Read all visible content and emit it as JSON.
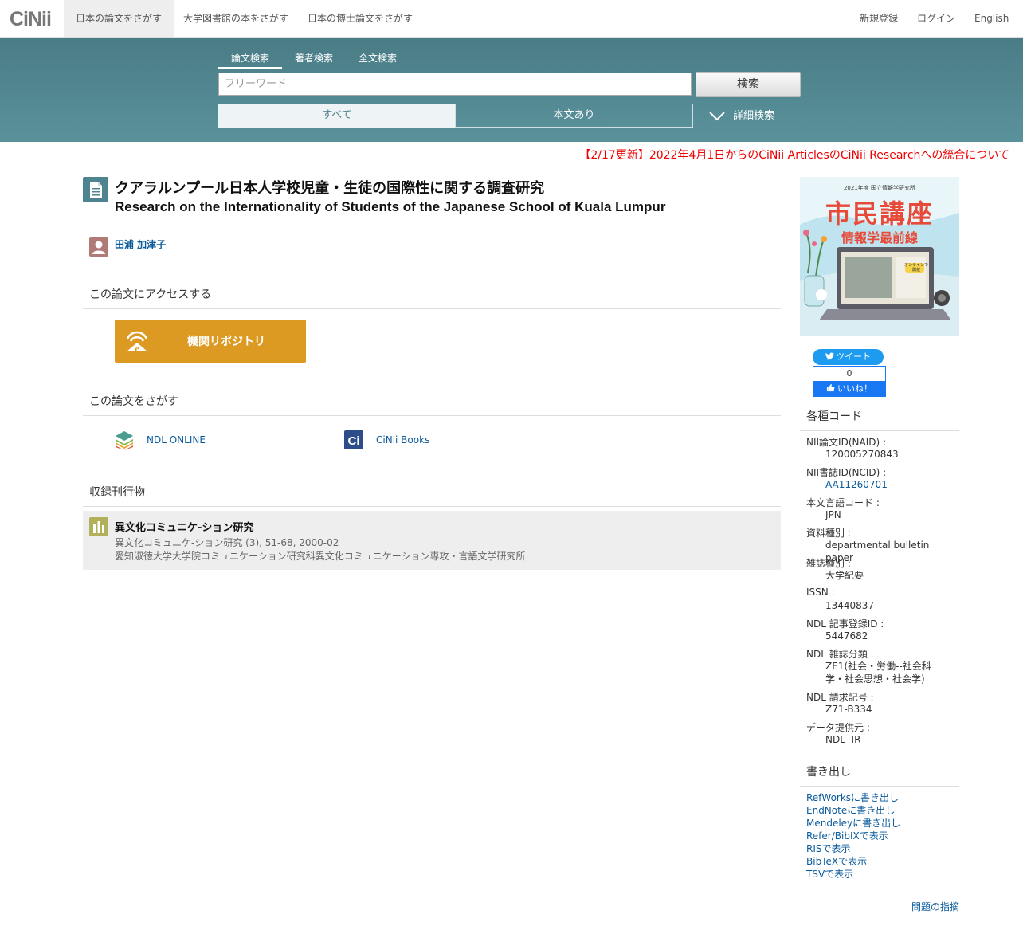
{
  "nav": {
    "logo": "CiNii",
    "tabs": [
      "日本の論文をさがす",
      "大学図書館の本をさがす",
      "日本の博士論文をさがす"
    ],
    "right": [
      "新規登録",
      "ログイン",
      "English"
    ]
  },
  "search": {
    "tabs": [
      "論文検索",
      "著者検索",
      "全文検索"
    ],
    "placeholder": "フリーワード",
    "button": "検索",
    "filters": [
      "すべて",
      "本文あり"
    ],
    "advanced": "詳細検索"
  },
  "notice": "【2/17更新】2022年4月1日からのCiNii ArticlesのCiNii Researchへの統合について",
  "article": {
    "title_ja": "クアラルンプール日本人学校児童・生徒の国際性に関する調査研究",
    "title_en": "Research on the Internationality of Students of the Japanese School of Kuala Lumpur",
    "author": "田浦 加津子"
  },
  "access": {
    "heading": "この論文にアクセスする",
    "repo_button": "機関リポジトリ"
  },
  "find": {
    "heading": "この論文をさがす",
    "links": [
      "NDL ONLINE",
      "CiNii Books"
    ]
  },
  "journal": {
    "heading": "収録刊行物",
    "name": "異文化コミュニケ-ション研究",
    "citation": "異文化コミュニケ-ション研究 (3), 51-68, 2000-02",
    "publisher": "愛知淑徳大学大学院コミュニケーション研究科異文化コミュニケーション専攻・言語文学研究所"
  },
  "ad": {
    "top": "2021年度 国立情報学研究所",
    "main": "市民講座",
    "sub": "情報学最前線",
    "badge": "オンラインで開催"
  },
  "social": {
    "tweet": "ツイート",
    "like_count": "0",
    "like": "いいね！"
  },
  "codes": {
    "heading": "各種コード",
    "items": [
      {
        "label": "NII論文ID(NAID) :",
        "value": "120005270843"
      },
      {
        "label": "NII書誌ID(NCID) :",
        "value": "AA11260701"
      },
      {
        "label": "本文言語コード :",
        "value": "JPN"
      },
      {
        "label": "資料種別 :",
        "value": "departmental bulletin paper"
      },
      {
        "label": "雑誌種別 :",
        "value": "大学紀要"
      },
      {
        "label": "ISSN :",
        "value": "13440837"
      },
      {
        "label": "NDL 記事登録ID :",
        "value": "5447682"
      },
      {
        "label": "NDL 雑誌分類 :",
        "value": "ZE1(社会・労働--社会科学・社会思想・社会学)"
      },
      {
        "label": "NDL 請求記号 :",
        "value": "Z71-B334"
      },
      {
        "label": "データ提供元 :",
        "value": "NDL  IR"
      }
    ]
  },
  "export": {
    "heading": "書き出し",
    "links": [
      "RefWorksに書き出し",
      "EndNoteに書き出し",
      "Mendeleyに書き出し",
      "Refer/BibIXで表示",
      "RISで表示",
      "BibTeXで表示",
      "TSVで表示"
    ]
  },
  "report": "問題の指摘",
  "colors": {
    "band": "#4a7c86",
    "link": "#0a5a9c",
    "repo": "#dd9a22",
    "notice": "#ee0000"
  }
}
